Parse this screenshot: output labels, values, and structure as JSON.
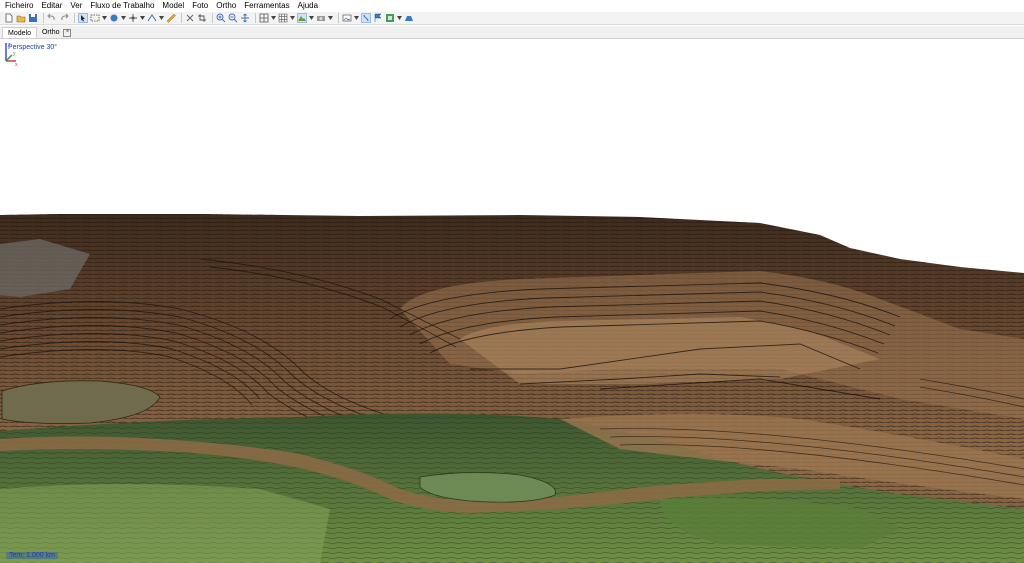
{
  "menu": [
    "Ficheiro",
    "Editar",
    "Ver",
    "Fluxo de Trabalho",
    "Model",
    "Foto",
    "Ortho",
    "Ferramentas",
    "Ajuda"
  ],
  "toolbar": {
    "icons": [
      "new-file-icon",
      "open-folder-icon",
      "save-icon",
      "undo-icon",
      "redo-icon",
      "select-icon",
      "rectangle-select-icon",
      "model-view-icon",
      "point-icon",
      "navigate-icon",
      "ruler-icon",
      "delete-icon",
      "crop-icon",
      "zoom-in-icon",
      "zoom-out-icon",
      "move-icon",
      "grid-icon",
      "texture-icon",
      "shading-icon",
      "camera-icon",
      "image-icon",
      "flag-icon",
      "markers-icon",
      "layers-icon",
      "ortho-icon"
    ]
  },
  "tabs": {
    "model": "Modelo",
    "ortho": "Ortho"
  },
  "viewport": {
    "projection": "Perspective 30°",
    "status": "Tem: 1.000 km"
  },
  "axes": {
    "x": "x",
    "y": "y",
    "z": "z"
  },
  "colors": {
    "sky": "#ffffff",
    "dark_soil": "#4a3324",
    "mid_soil": "#8a6442",
    "light_soil": "#a9825c",
    "vegetation": "#5f7a3c",
    "bright_grass": "#7e9b4e",
    "water": "#6d7a5a",
    "accent_blue": "#1a3fb0"
  }
}
